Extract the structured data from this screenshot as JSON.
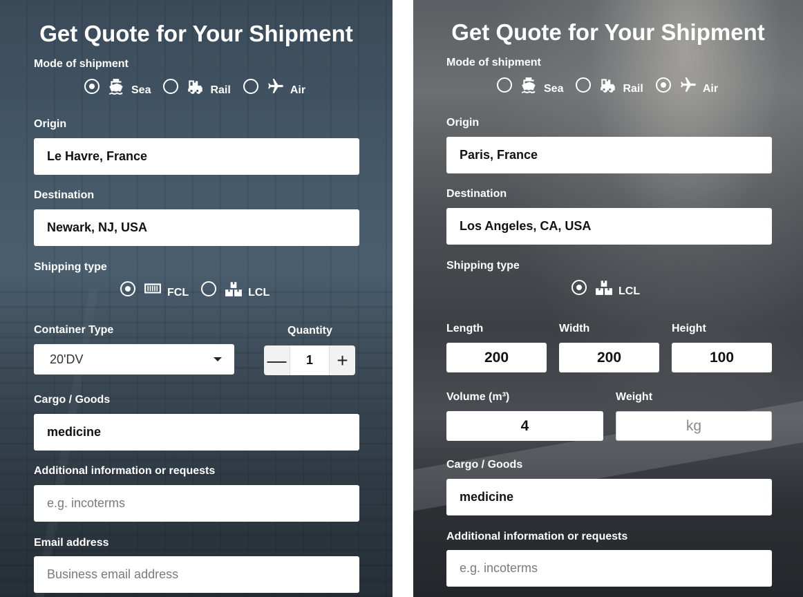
{
  "left": {
    "title": "Get Quote for Your Shipment",
    "mode_label": "Mode of shipment",
    "modes": [
      {
        "label": "Sea",
        "icon": "ship-icon",
        "checked": true
      },
      {
        "label": "Rail",
        "icon": "train-icon",
        "checked": false
      },
      {
        "label": "Air",
        "icon": "airplane-icon",
        "checked": false
      }
    ],
    "origin_label": "Origin",
    "origin_value": "Le Havre, France",
    "destination_label": "Destination",
    "destination_value": "Newark, NJ, USA",
    "shipping_type_label": "Shipping type",
    "shipping_types": [
      {
        "label": "FCL",
        "icon": "container-icon",
        "checked": true
      },
      {
        "label": "LCL",
        "icon": "boxes-icon",
        "checked": false
      }
    ],
    "container_type_label": "Container Type",
    "container_type_value": "20'DV",
    "quantity_label": "Quantity",
    "quantity_value": "1",
    "minus": "—",
    "plus": "+",
    "cargo_label": "Cargo / Goods",
    "cargo_value": "medicine",
    "additional_label": "Additional information or requests",
    "additional_placeholder": "e.g. incoterms",
    "email_label": "Email address",
    "email_placeholder": "Business email address"
  },
  "right": {
    "title": "Get Quote for Your Shipment",
    "mode_label": "Mode of shipment",
    "modes": [
      {
        "label": "Sea",
        "icon": "ship-icon",
        "checked": false
      },
      {
        "label": "Rail",
        "icon": "train-icon",
        "checked": false
      },
      {
        "label": "Air",
        "icon": "airplane-icon",
        "checked": true
      }
    ],
    "origin_label": "Origin",
    "origin_value": "Paris, France",
    "destination_label": "Destination",
    "destination_value": "Los Angeles, CA, USA",
    "shipping_type_label": "Shipping type",
    "shipping_types": [
      {
        "label": "LCL",
        "icon": "boxes-icon",
        "checked": true
      }
    ],
    "length_label": "Length",
    "length_value": "200",
    "width_label": "Width",
    "width_value": "200",
    "height_label": "Height",
    "height_value": "100",
    "volume_label": "Volume (m³)",
    "volume_value": "4",
    "weight_label": "Weight",
    "weight_placeholder": "kg",
    "cargo_label": "Cargo / Goods",
    "cargo_value": "medicine",
    "additional_label": "Additional information or requests",
    "additional_placeholder": "e.g. incoterms"
  }
}
